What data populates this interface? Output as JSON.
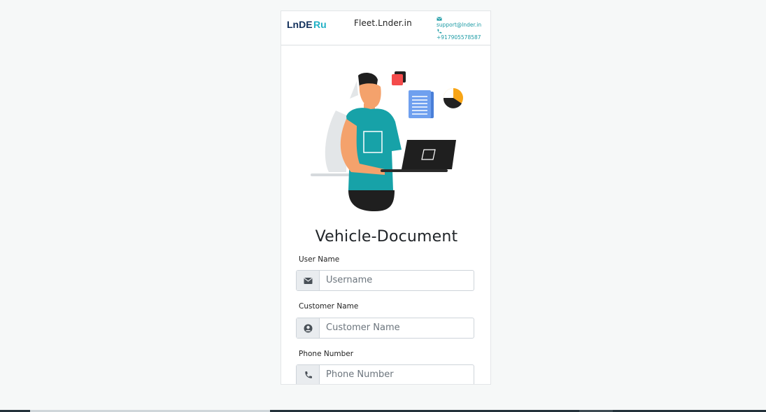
{
  "header": {
    "site_title": "Fleet.Lnder.in",
    "email": "support@lnder.in",
    "phone": "+917905578587",
    "logo_text": "LnDERu"
  },
  "page": {
    "heading": "Vehicle-Document"
  },
  "form": {
    "fields": [
      {
        "label": "User Name",
        "placeholder": "Username",
        "icon": "envelope-icon"
      },
      {
        "label": "Customer Name",
        "placeholder": "Customer Name",
        "icon": "user-circle-icon"
      },
      {
        "label": "Phone Number",
        "placeholder": "Phone Number",
        "icon": "phone-icon"
      }
    ]
  },
  "colors": {
    "accent": "#1a9aa4",
    "logo_dark": "#13315c",
    "logo_cyan": "#21b1c6",
    "shirt": "#17a2a8"
  }
}
